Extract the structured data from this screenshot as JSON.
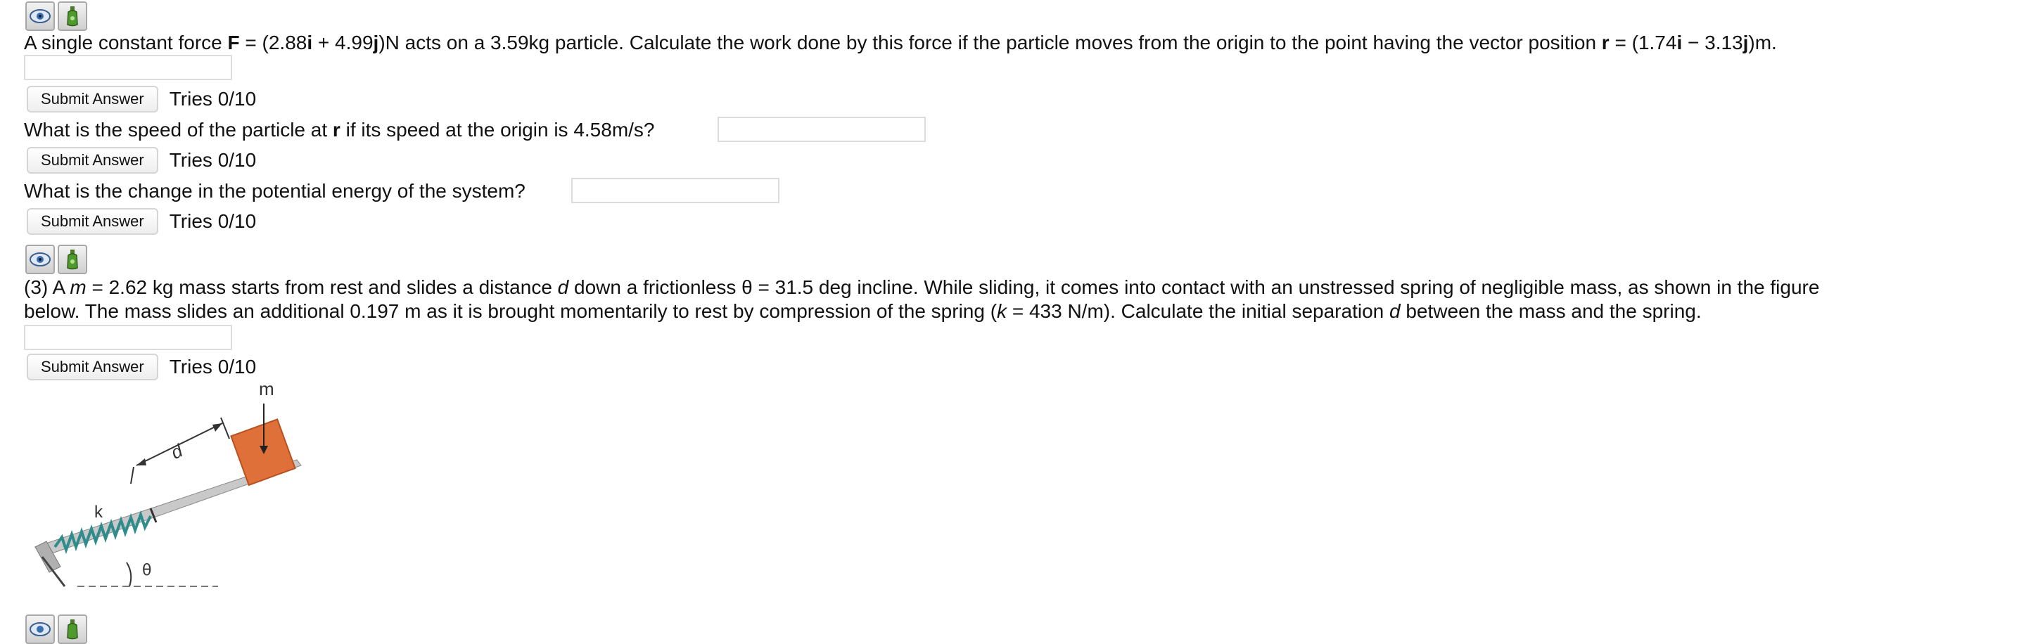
{
  "q1": {
    "t1": "A single constant force ",
    "F": "F",
    "t2": " = (2.88",
    "i1": "i",
    "t3": " + 4.99",
    "j1": "j",
    "t4": ")N acts on a 3.59kg particle. Calculate the work done by this force if the particle moves from the origin to the point having the vector position ",
    "r": "r",
    "t5": " = (1.74",
    "i2": "i",
    "t6": " − 3.13",
    "j2": "j",
    "t7": ")m."
  },
  "q2": {
    "t1": "What is the speed of the particle at ",
    "r": "r",
    "t2": " if its speed at the origin is 4.58m/s?"
  },
  "q3": {
    "t1": "What is the change in the potential energy of the system?"
  },
  "q4": {
    "line1_a": "(3) A ",
    "m": "m",
    "line1_b": " = 2.62 kg mass starts from rest and slides a distance ",
    "d1": "d",
    "line1_c": " down a frictionless θ = 31.5 deg incline. While sliding, it comes into contact with an unstressed spring of negligible mass, as shown in the figure",
    "line2_a": "below. The mass slides an additional 0.197 m as it is brought momentarily to rest by compression of the spring (",
    "k": "k",
    "line2_b": " = 433 N/m). Calculate the initial separation ",
    "d2": "d",
    "line2_c": " between the mass and the spring."
  },
  "submit_label": "Submit Answer",
  "tries": "Tries 0/10",
  "figure_labels": {
    "m": "m",
    "d": "d",
    "k": "k",
    "theta": "θ"
  },
  "icons": [
    "eye-view-icon",
    "hint-bottle-icon"
  ],
  "colors": {
    "mass_block": "#e0703a",
    "spring": "#2f8c8c",
    "incline": "#333333"
  }
}
